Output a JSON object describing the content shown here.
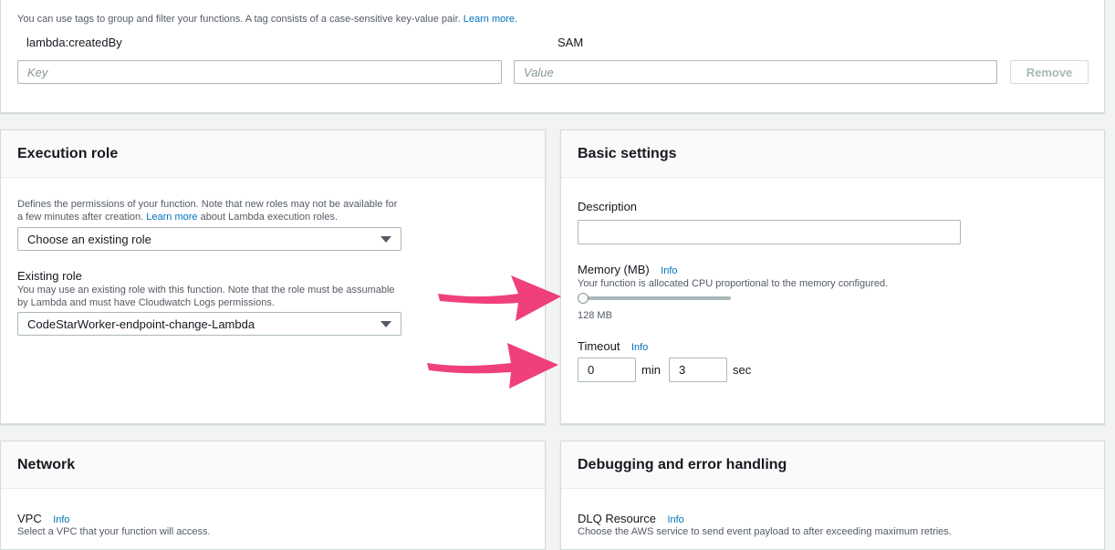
{
  "tags": {
    "description": "You can use tags to group and filter your functions. A tag consists of a case-sensitive key-value pair.",
    "learn_more": "Learn more.",
    "existing_key": "lambda:createdBy",
    "existing_value": "SAM",
    "key_placeholder": "Key",
    "value_placeholder": "Value",
    "remove_label": "Remove"
  },
  "execution_role": {
    "title": "Execution role",
    "description_part1": "Defines the permissions of your function. Note that new roles may not be available for a few minutes after creation.",
    "learn_more": "Learn more",
    "description_part2": "about Lambda execution roles.",
    "role_select_value": "Choose an existing role",
    "existing_role_label": "Existing role",
    "existing_role_help": "You may use an existing role with this function. Note that the role must be assumable by Lambda and must have Cloudwatch Logs permissions.",
    "existing_role_value": "CodeStarWorker-endpoint-change-Lambda"
  },
  "basic_settings": {
    "title": "Basic settings",
    "description_label": "Description",
    "description_value": "",
    "memory_label": "Memory (MB)",
    "memory_info": "Info",
    "memory_help": "Your function is allocated CPU proportional to the memory configured.",
    "memory_value_text": "128 MB",
    "memory_fraction": 0.0,
    "timeout_label": "Timeout",
    "timeout_info": "Info",
    "timeout_min": "0",
    "timeout_min_unit": "min",
    "timeout_sec": "3",
    "timeout_sec_unit": "sec"
  },
  "network": {
    "title": "Network",
    "vpc_label": "VPC",
    "vpc_info": "Info",
    "vpc_help": "Select a VPC that your function will access."
  },
  "debugging": {
    "title": "Debugging and error handling",
    "dlq_label": "DLQ Resource",
    "dlq_info": "Info",
    "dlq_help": "Choose the AWS service to send event payload to after exceeding maximum retries."
  },
  "colors": {
    "annotation_arrow": "#f0407a",
    "link": "#0073bb"
  }
}
